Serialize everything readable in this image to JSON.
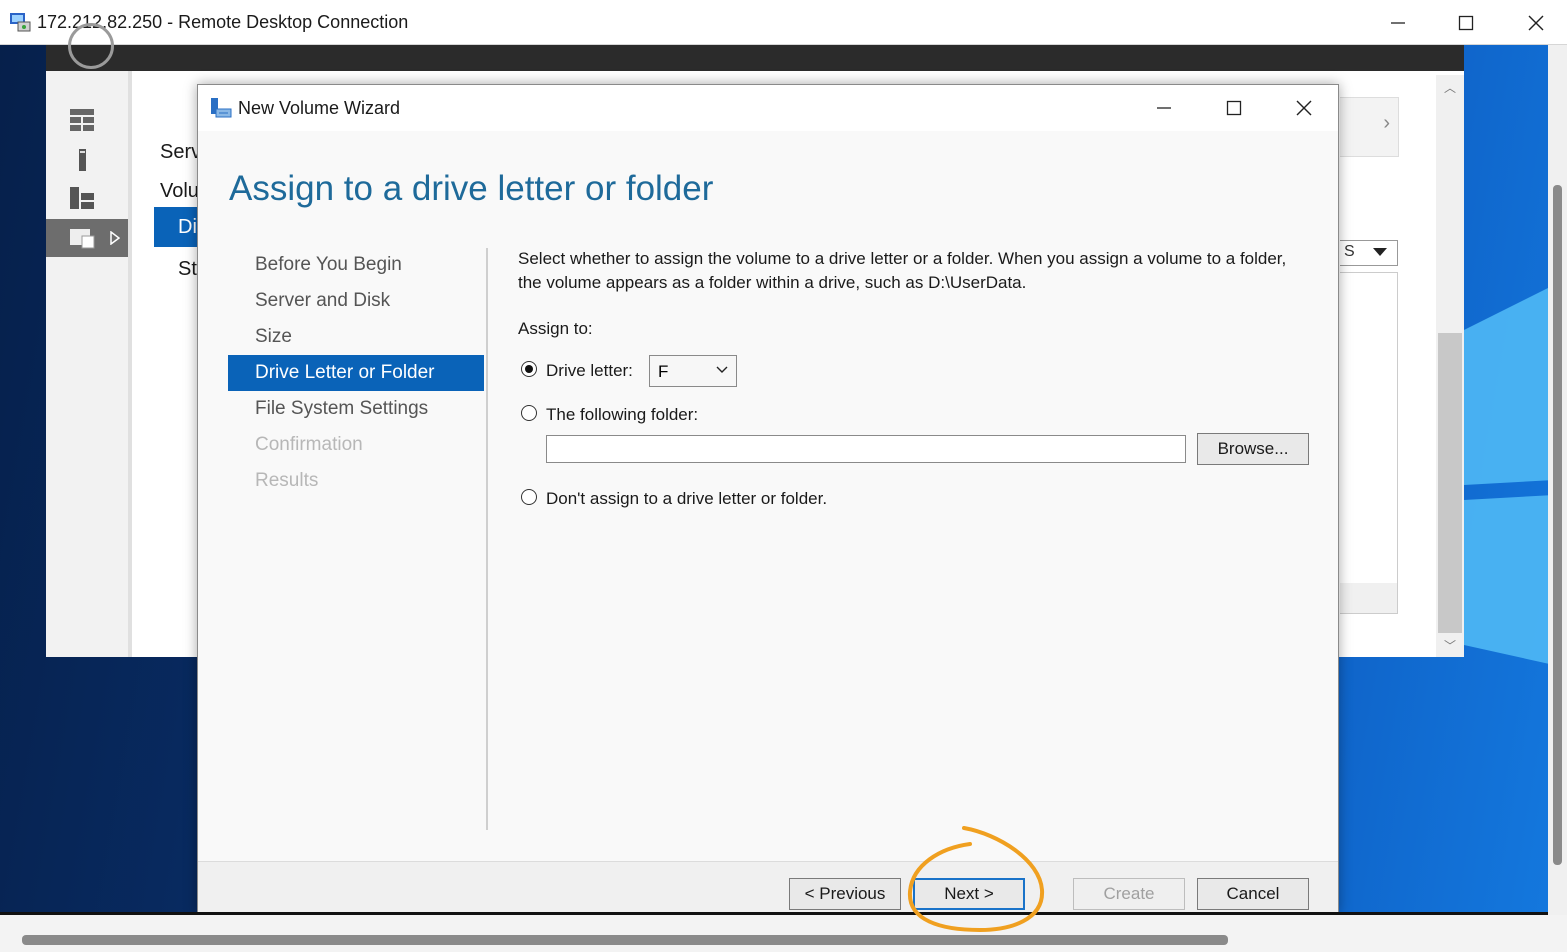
{
  "rdp": {
    "title": "172.212.82.250 - Remote Desktop Connection"
  },
  "server_manager": {
    "nav_items": [
      "Serv",
      "Volu",
      "Di",
      "St"
    ]
  },
  "background_panel": {
    "dropdown_text": "S"
  },
  "wizard": {
    "title": "New Volume Wizard",
    "heading": "Assign to a drive letter or folder",
    "steps": [
      {
        "label": "Before You Begin",
        "state": "normal"
      },
      {
        "label": "Server and Disk",
        "state": "normal"
      },
      {
        "label": "Size",
        "state": "normal"
      },
      {
        "label": "Drive Letter or Folder",
        "state": "active"
      },
      {
        "label": "File System Settings",
        "state": "normal"
      },
      {
        "label": "Confirmation",
        "state": "disabled"
      },
      {
        "label": "Results",
        "state": "disabled"
      }
    ],
    "description": "Select whether to assign the volume to a drive letter or a folder. When you assign a volume to a folder, the volume appears as a folder within a drive, such as D:\\UserData.",
    "assign_to_label": "Assign to:",
    "options": {
      "drive_letter_label": "Drive letter:",
      "drive_letter_value": "F",
      "folder_label": "The following folder:",
      "folder_value": "",
      "none_label": "Don't assign to a drive letter or folder.",
      "selected": "drive_letter"
    },
    "buttons": {
      "browse": "Browse...",
      "previous": "< Previous",
      "next": "Next >",
      "create": "Create",
      "cancel": "Cancel"
    }
  },
  "colors": {
    "accent": "#0a63b8",
    "heading": "#1e6a9a",
    "annotation": "#f0a020"
  }
}
